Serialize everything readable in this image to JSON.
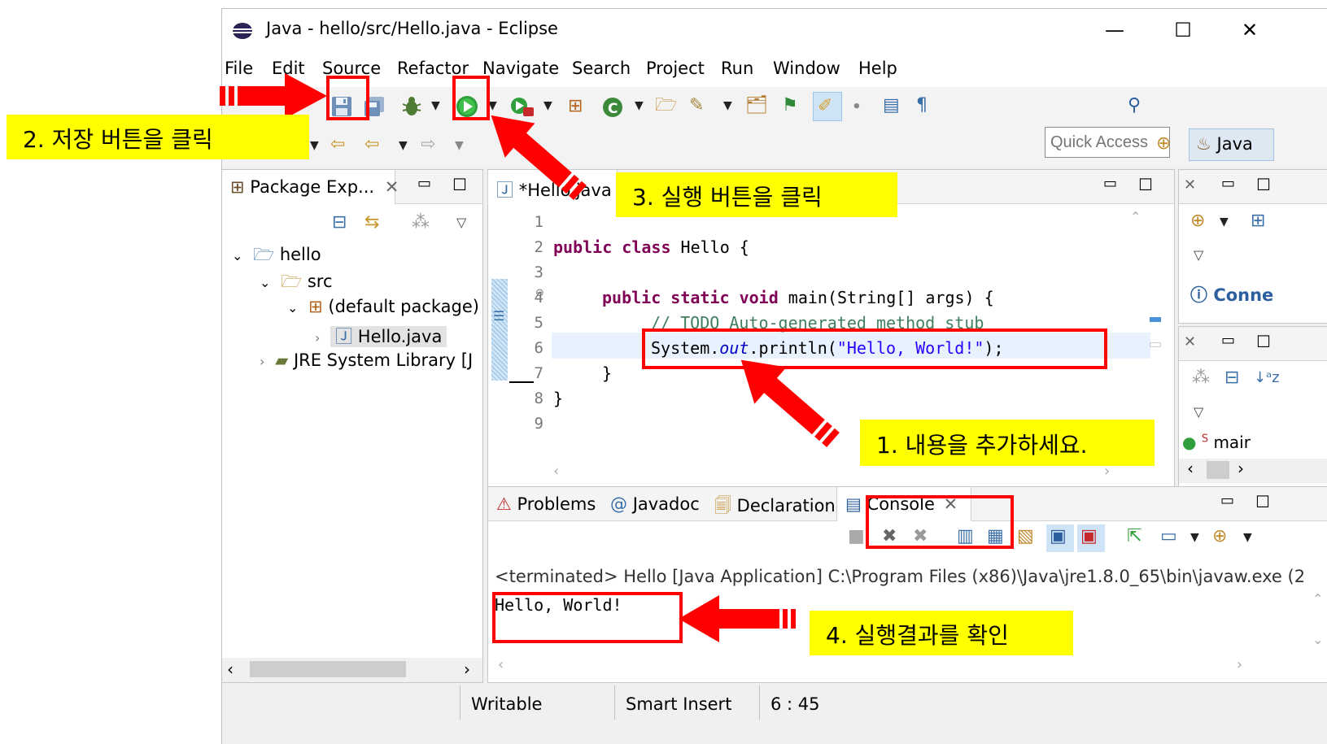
{
  "window": {
    "title": "Java - hello/src/Hello.java - Eclipse",
    "controls": [
      "—",
      "☐",
      "✕"
    ]
  },
  "menu": [
    "File",
    "Edit",
    "Source",
    "Refactor",
    "Navigate",
    "Search",
    "Project",
    "Run",
    "Window",
    "Help"
  ],
  "toolbar": {
    "quick_access_placeholder": "Quick Access",
    "perspective_label": "Java"
  },
  "package_explorer": {
    "tab_label": "Package Exp...",
    "tree": [
      {
        "label": "hello"
      },
      {
        "label": "src"
      },
      {
        "label": "(default package)"
      },
      {
        "label": "Hello.java"
      },
      {
        "label": "JRE System Library [J"
      }
    ]
  },
  "editor": {
    "tab_label": "*Hello.java",
    "lines": [
      "1",
      "2",
      "3",
      "4",
      "5",
      "6",
      "7",
      "8",
      "9"
    ],
    "code": {
      "l2_kw": "public class",
      "l2_rest": " Hello {",
      "l4_kw": "public static void",
      "l4_rest": " main(String[] args) {",
      "l5_comment": "// TODO Auto-generated method stub",
      "l6_a": "System.",
      "l6_out": "out",
      "l6_b": ".println(",
      "l6_str": "\"Hello, World!\"",
      "l6_c": ");",
      "l7": "}",
      "l8": "}"
    }
  },
  "outline": {
    "connect_label": "Conne",
    "method_label": "mair"
  },
  "bottom_panel": {
    "tabs": [
      "Problems",
      "Javadoc",
      "Declaration",
      "Console"
    ],
    "console_header": "<terminated> Hello [Java Application] C:\\Program Files (x86)\\Java\\jre1.8.0_65\\bin\\javaw.exe (2",
    "console_output": "Hello, World!"
  },
  "statusbar": {
    "writable": "Writable",
    "insert_mode": "Smart Insert",
    "position": "6 : 45"
  },
  "annotations": {
    "step1": "1. 내용을 추가하세요.",
    "step2": "2. 저장 버튼을 클릭",
    "step3": "3. 실행 버튼을 클릭",
    "step4": "4. 실행결과를 확인"
  },
  "colors": {
    "annotation_red": "#ff0000",
    "annotation_yellow": "#ffff00",
    "keyword": "#7f0055",
    "comment": "#3f7f5f",
    "string": "#2a00ff"
  }
}
